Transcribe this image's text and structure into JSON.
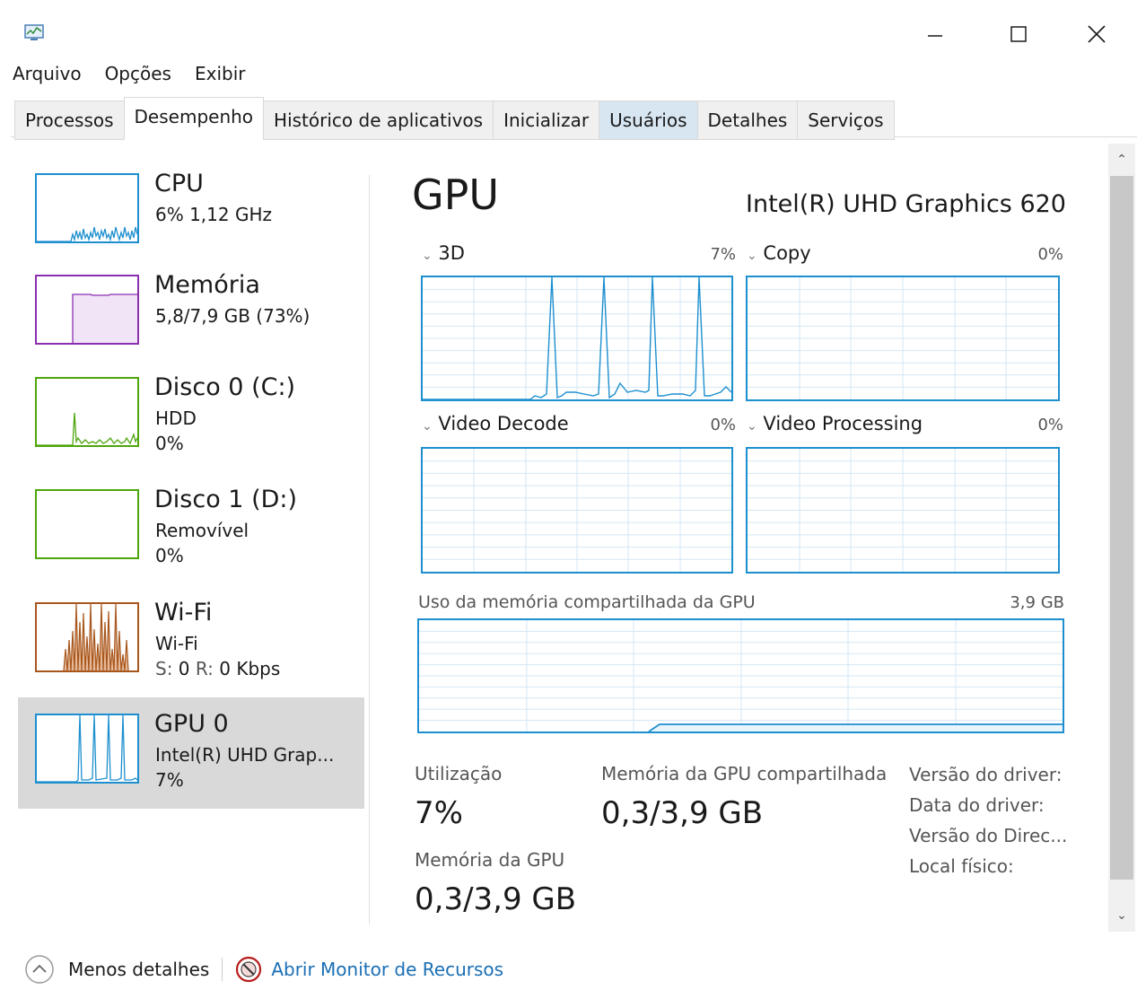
{
  "window": {
    "minimize_icon": "minimize-icon",
    "maximize_icon": "maximize-icon",
    "close_icon": "close-icon"
  },
  "menu": {
    "items": [
      "Arquivo",
      "Opções",
      "Exibir"
    ]
  },
  "tabs": [
    "Processos",
    "Desempenho",
    "Histórico de aplicativos",
    "Inicializar",
    "Usuários",
    "Detalhes",
    "Serviços"
  ],
  "sidebar": {
    "items": [
      {
        "title": "CPU",
        "line1": "6% 1,12 GHz",
        "line2": "",
        "color": "#1d8fcf"
      },
      {
        "title": "Memória",
        "line1": "5,8/7,9 GB (73%)",
        "line2": "",
        "color": "#8b2fb0"
      },
      {
        "title": "Disco 0 (C:)",
        "line1": "HDD",
        "line2": "0%",
        "color": "#4da60c"
      },
      {
        "title": "Disco 1 (D:)",
        "line1": "Removível",
        "line2": "0%",
        "color": "#4da60c"
      },
      {
        "title": "Wi-Fi",
        "line1": "Wi-Fi",
        "line2_s": "S:",
        "line2_s_val": "0",
        "line2_r": "R:",
        "line2_r_val": "0 Kbps",
        "color": "#a7561c"
      },
      {
        "title": "GPU 0",
        "line1": "Intel(R) UHD Grap...",
        "line2": "7%",
        "color": "#1d8fcf"
      }
    ]
  },
  "main": {
    "title": "GPU",
    "gpu_name": "Intel(R) UHD Graphics 620",
    "graphs": [
      {
        "label": "3D",
        "pct": "7%"
      },
      {
        "label": "Copy",
        "pct": "0%"
      },
      {
        "label": "Video Decode",
        "pct": "0%"
      },
      {
        "label": "Video Processing",
        "pct": "0%"
      }
    ],
    "shared_mem_label": "Uso da memória compartilhada da GPU",
    "shared_mem_max": "3,9 GB",
    "stats": {
      "util_label": "Utilização",
      "util_value": "7%",
      "shared_label": "Memória da GPU compartilhada",
      "shared_value": "0,3/3,9 GB",
      "gpu_mem_label": "Memória da GPU",
      "gpu_mem_value": "0,3/3,9 GB"
    },
    "info": {
      "driver_version": "Versão do driver:",
      "driver_date": "Data do driver:",
      "directx_version": "Versão do Direc...",
      "physical_location": "Local físico:"
    }
  },
  "footer": {
    "less_details": "Menos detalhes",
    "open_monitor": "Abrir Monitor de Recursos"
  }
}
